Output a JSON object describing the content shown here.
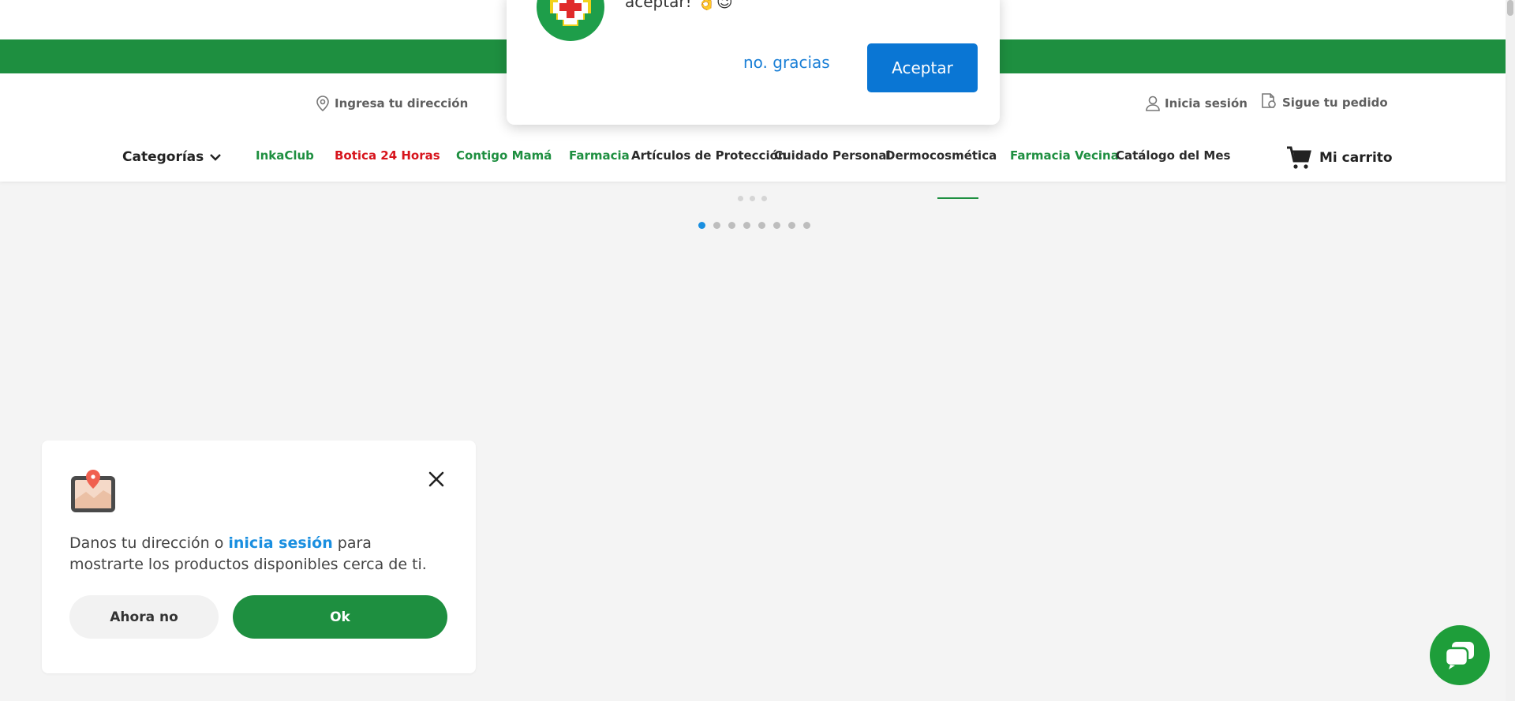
{
  "notification": {
    "message": "aceptar! 👌😉",
    "decline_label": "no. gracias",
    "accept_label": "Aceptar"
  },
  "header": {
    "address_link": "Ingresa tu dirección",
    "login_link": "Inicia sesión",
    "track_link": "Sigue tu pedido",
    "categories_label": "Categorías",
    "cart_label": "Mi carrito"
  },
  "nav": {
    "items": [
      {
        "label": "InkaClub",
        "color": "#1e8f40"
      },
      {
        "label": "Botica 24 Horas",
        "color": "#d7141c"
      },
      {
        "label": "Contigo Mamá",
        "color": "#1e8f40"
      },
      {
        "label": "Farmacia",
        "color": "#1e8f40"
      },
      {
        "label": "Artículos de Protección",
        "color": "#2b2b2b"
      },
      {
        "label": "Cuidado Personal",
        "color": "#2b2b2b"
      },
      {
        "label": "Dermocosmética",
        "color": "#2b2b2b"
      },
      {
        "label": "Farmacia Vecina",
        "color": "#1e8f40"
      },
      {
        "label": "Catálogo del Mes",
        "color": "#2b2b2b"
      }
    ]
  },
  "carousel": {
    "slide_count": 8,
    "active_index": 0
  },
  "location_prompt": {
    "text_before": "Danos tu dirección o ",
    "link_text": "inicia sesión",
    "text_after": " para mostrarte los productos disponibles cerca de ti.",
    "later_label": "Ahora no",
    "ok_label": "Ok"
  },
  "colors": {
    "brand_green": "#1e8f40",
    "accent_blue": "#0a76d4",
    "alert_red": "#d7141c"
  }
}
